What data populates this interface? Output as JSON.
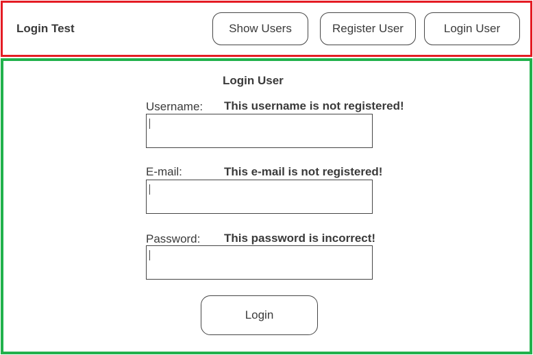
{
  "header": {
    "title": "Login Test",
    "nav": {
      "show_users": "Show Users",
      "register_user": "Register User",
      "login_user": "Login User"
    },
    "border_color": "#e41b23"
  },
  "main": {
    "title": "Login User",
    "border_color": "#21b14c",
    "fields": {
      "username": {
        "label": "Username:",
        "error": "This username is not registered!",
        "value": ""
      },
      "email": {
        "label": "E-mail:",
        "error": "This e-mail is not registered!",
        "value": ""
      },
      "password": {
        "label": "Password:",
        "error": "This password is incorrect!",
        "value": ""
      }
    },
    "submit_label": "Login"
  }
}
